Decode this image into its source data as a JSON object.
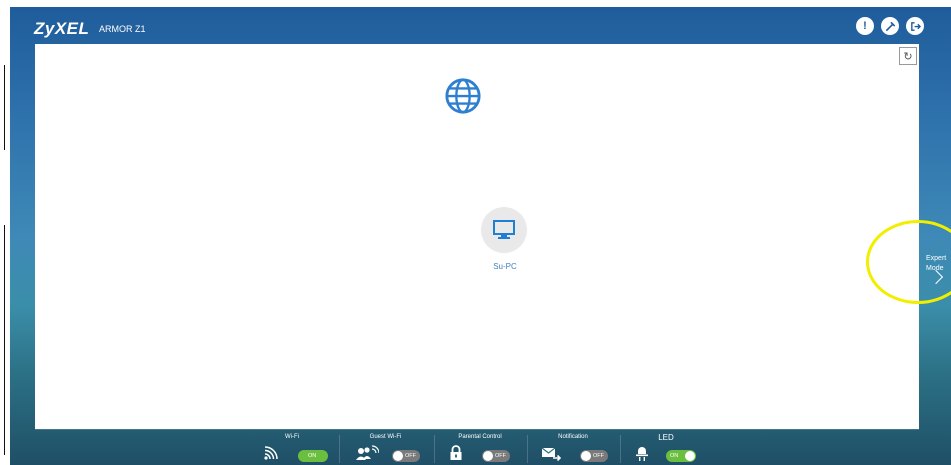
{
  "header": {
    "brand": "ZyXEL",
    "model": "ARMOR Z1",
    "icons": [
      "alert-icon",
      "tools-icon",
      "logout-icon"
    ]
  },
  "canvas": {
    "refresh_icon": "refresh-icon",
    "internet_icon": "globe-icon",
    "device": {
      "icon": "monitor-icon",
      "name": "Su-PC"
    }
  },
  "expert_mode": {
    "line1": "Expert",
    "line2": "Mode"
  },
  "bottom_bar": {
    "wifi": {
      "label": "Wi-Fi",
      "state": "ON"
    },
    "guest_wifi": {
      "label": "Guest Wi-Fi",
      "state": "OFF"
    },
    "parental_control": {
      "label": "Parental Control",
      "state": "OFF"
    },
    "notification": {
      "label": "Notification",
      "state": "OFF"
    },
    "led": {
      "label": "LED",
      "state": "ON"
    }
  },
  "colors": {
    "accent": "#3d82c4",
    "toggle_on": "#6cbf3e",
    "toggle_off": "#7a7a7a",
    "highlight": "#f2ee00"
  }
}
